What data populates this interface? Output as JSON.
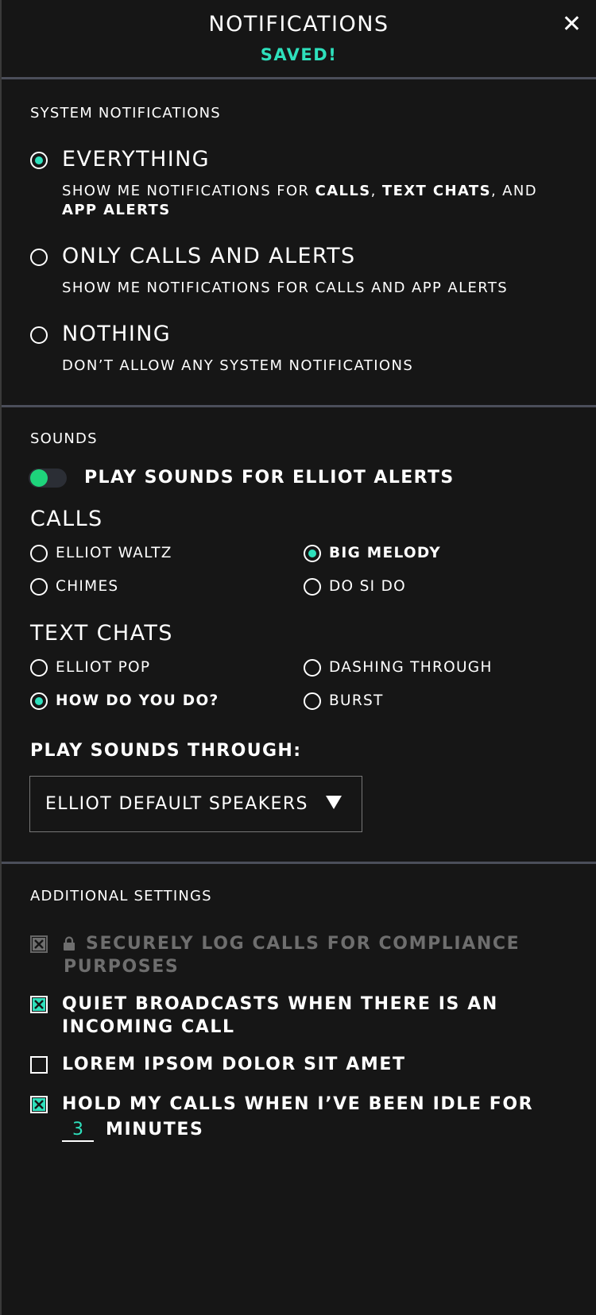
{
  "header": {
    "title": "NOTIFICATIONS",
    "status": "SAVED!",
    "close_icon": "close-icon"
  },
  "system": {
    "label": "SYSTEM NOTIFICATIONS",
    "options": [
      {
        "title": "EVERYTHING",
        "selected": true,
        "desc_parts": [
          "SHOW ME NOTIFICATIONS FOR ",
          "CALLS",
          ", ",
          "TEXT CHATS",
          ", AND",
          "APP ALERTS"
        ]
      },
      {
        "title": "ONLY CALLS AND ALERTS",
        "selected": false,
        "desc": "SHOW ME NOTIFICATIONS FOR CALLS AND APP ALERTS"
      },
      {
        "title": "NOTHING",
        "selected": false,
        "desc": "DON’T ALLOW ANY SYSTEM NOTIFICATIONS"
      }
    ]
  },
  "sounds": {
    "label": "SOUNDS",
    "toggle_label": "PLAY SOUNDS FOR ELLIOT ALERTS",
    "toggle_on": true,
    "calls": {
      "title": "CALLS",
      "options": [
        "ELLIOT WALTZ",
        "BIG MELODY",
        "CHIMES",
        "DO SI DO"
      ],
      "selected": "BIG MELODY"
    },
    "text_chats": {
      "title": "TEXT CHATS",
      "options": [
        "ELLIOT POP",
        "DASHING THROUGH",
        "HOW DO YOU DO?",
        "BURST"
      ],
      "selected": "HOW DO YOU DO?"
    },
    "through_label": "PLAY SOUNDS THROUGH:",
    "device": "ELLIOT DEFAULT SPEAKERS"
  },
  "additional": {
    "label": "ADDITIONAL SETTINGS",
    "items": [
      {
        "line1": "SECURELY LOG CALLS FOR COMPLIANCE",
        "line2": "PURPOSES",
        "checked": true,
        "disabled": true,
        "icon": "lock-icon"
      },
      {
        "line1": "QUIET BROADCASTS WHEN THERE IS AN",
        "line2": "INCOMING CALL",
        "checked": true,
        "disabled": false
      },
      {
        "line1": "LOREM IPSOM DOLOR SIT AMET",
        "checked": false,
        "disabled": false
      },
      {
        "line1": "HOLD MY CALLS WHEN I’VE BEEN IDLE FOR",
        "checked": true,
        "disabled": false
      }
    ],
    "idle_minutes": "3",
    "minutes_label": "MINUTES"
  },
  "colors": {
    "background": "#161616",
    "accent": "#2ee0bc",
    "toggle_knob": "#1ed47b",
    "divider": "#4b4e5a"
  }
}
